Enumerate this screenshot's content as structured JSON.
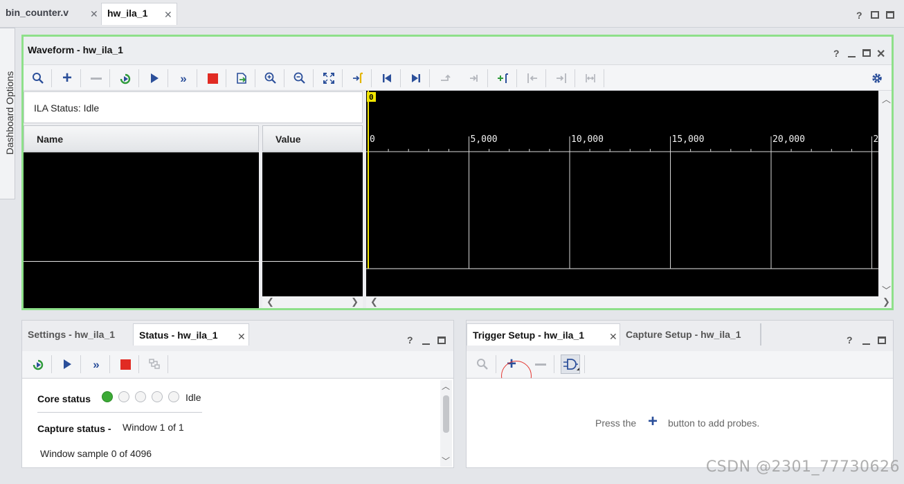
{
  "editor_tabs": [
    {
      "label": "bin_counter.v",
      "active": false
    },
    {
      "label": "hw_ila_1",
      "active": true
    }
  ],
  "window_controls": {
    "help": "?",
    "restore": "□",
    "maximize": "□"
  },
  "dashboard_tab": {
    "label": "Dashboard Options"
  },
  "waveform": {
    "title": "Waveform - hw_ila_1",
    "controls": {
      "help": "?",
      "minimize": "_",
      "maximize": "□",
      "close": "✕"
    },
    "toolbar": [
      "search-icon",
      "add-icon",
      "remove-icon",
      "run-trigger-icon",
      "run-icon",
      "run-immediate-icon",
      "stop-icon",
      "export-icon",
      "zoom-in-icon",
      "zoom-out-icon",
      "zoom-fit-icon",
      "go-to-cursor-icon",
      "previous-transition-icon",
      "next-transition-icon",
      "add-marker-icon",
      "move-marker-icon",
      "add-marker-green-icon",
      "previous-marker-icon",
      "next-marker-icon",
      "swap-cursors-icon",
      "settings-gear-icon"
    ],
    "ila_status_label": "ILA Status:",
    "ila_status_value": "Idle",
    "name_header": "Name",
    "value_header": "Value",
    "cursor_label": "0",
    "time_ticks": [
      "0",
      "5,000",
      "10,000",
      "15,000",
      "20,000",
      "2"
    ],
    "accent": "#8ee08a",
    "cursor_color": "#f2e600"
  },
  "settings_panel": {
    "tabs": [
      {
        "label": "Settings - hw_ila_1",
        "active": false
      },
      {
        "label": "Status - hw_ila_1",
        "active": true
      }
    ],
    "controls": {
      "help": "?",
      "minimize": "_",
      "maximize": "□"
    },
    "core_status_label": "Core status",
    "core_status_value": "Idle",
    "capture_status_label": "Capture status -",
    "capture_status_value": "Window 1 of 1",
    "window_sample": "Window sample 0 of 4096"
  },
  "trigger_panel": {
    "tabs": [
      {
        "label": "Trigger Setup - hw_ila_1",
        "active": true
      },
      {
        "label": "Capture Setup - hw_ila_1",
        "active": false
      }
    ],
    "controls": {
      "help": "?",
      "minimize": "_",
      "maximize": "□"
    },
    "empty_prefix": "Press the",
    "empty_suffix": "button to add probes."
  },
  "watermark": "CSDN @2301_77730626"
}
